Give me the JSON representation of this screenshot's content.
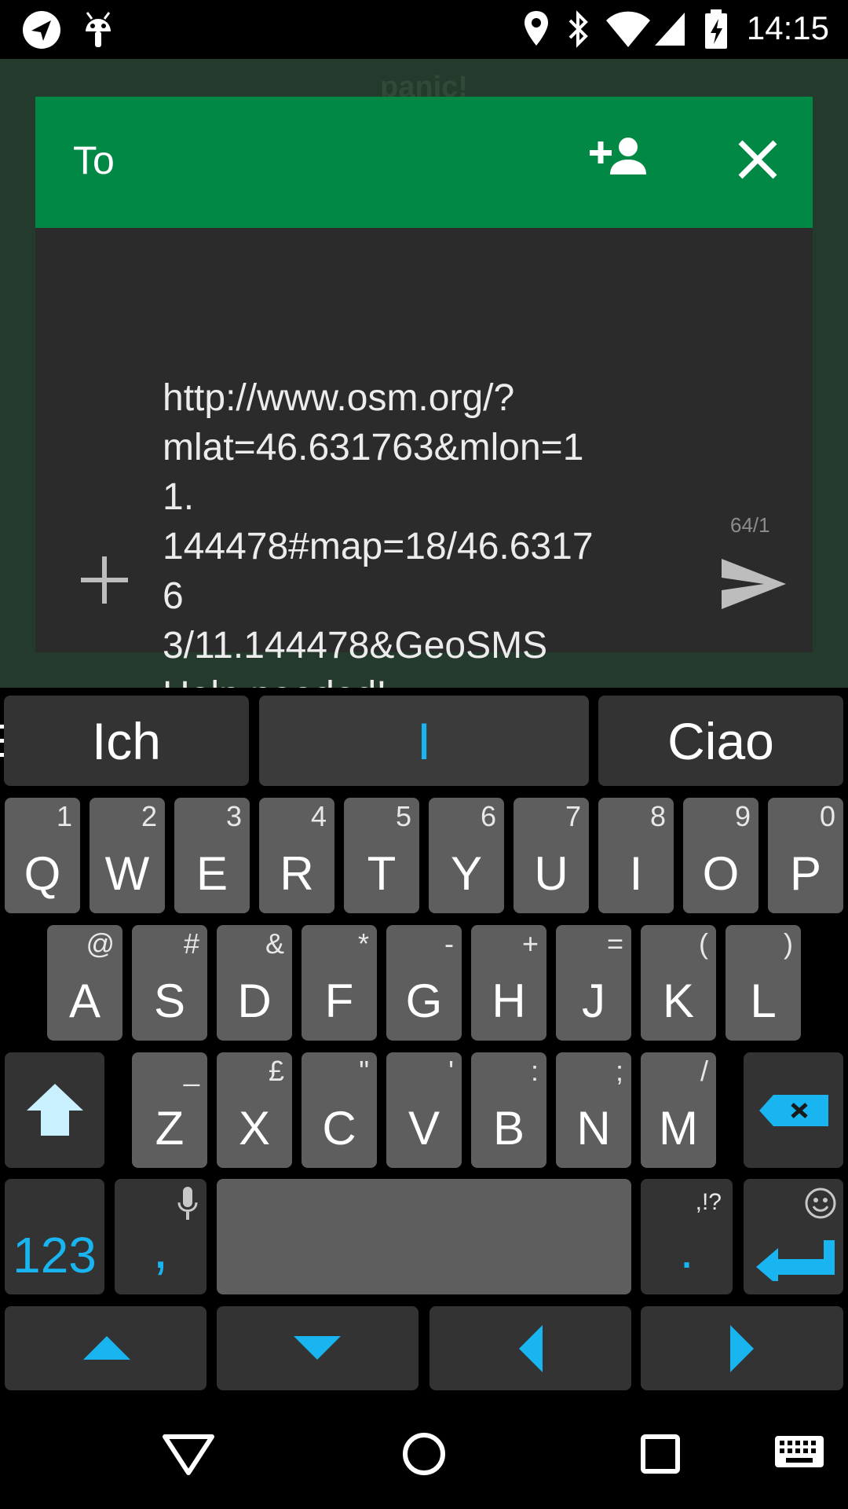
{
  "status_bar": {
    "time": "14:15",
    "icons": [
      "navigation-icon",
      "android-debug-icon",
      "location-icon",
      "bluetooth-icon",
      "wifi-icon",
      "cell-signal-icon",
      "battery-charging-icon"
    ]
  },
  "app": {
    "title": "panic!"
  },
  "dialog": {
    "to_label": "To",
    "message_line1": "http://www.osm.org/?",
    "message_line2": "mlat=46.631763&mlon=11.",
    "message_line3": "144478#map=18/46.63176",
    "message_line4": "3/11.144478&GeoSMS",
    "message_line5": "Help needed!",
    "char_count": "64/1"
  },
  "keyboard": {
    "suggestions": [
      "Ich",
      "I",
      "Ciao"
    ],
    "row1": [
      {
        "label": "Q",
        "hint": "1"
      },
      {
        "label": "W",
        "hint": "2"
      },
      {
        "label": "E",
        "hint": "3"
      },
      {
        "label": "R",
        "hint": "4"
      },
      {
        "label": "T",
        "hint": "5"
      },
      {
        "label": "Y",
        "hint": "6"
      },
      {
        "label": "U",
        "hint": "7"
      },
      {
        "label": "I",
        "hint": "8"
      },
      {
        "label": "O",
        "hint": "9"
      },
      {
        "label": "P",
        "hint": "0"
      }
    ],
    "row2": [
      {
        "label": "A",
        "hint": "@"
      },
      {
        "label": "S",
        "hint": "#"
      },
      {
        "label": "D",
        "hint": "&"
      },
      {
        "label": "F",
        "hint": "*"
      },
      {
        "label": "G",
        "hint": "-"
      },
      {
        "label": "H",
        "hint": "+"
      },
      {
        "label": "J",
        "hint": "="
      },
      {
        "label": "K",
        "hint": "("
      },
      {
        "label": "L",
        "hint": ")"
      }
    ],
    "row3": [
      {
        "label": "Z",
        "hint": "_"
      },
      {
        "label": "X",
        "hint": "£"
      },
      {
        "label": "C",
        "hint": "\""
      },
      {
        "label": "V",
        "hint": "'"
      },
      {
        "label": "B",
        "hint": ":"
      },
      {
        "label": "N",
        "hint": ";"
      },
      {
        "label": "M",
        "hint": "/"
      }
    ],
    "num_key": "123",
    "comma_key": ",",
    "period_key": ".",
    "period_hint": ",!?",
    "accent_color": "#19b5f0"
  }
}
